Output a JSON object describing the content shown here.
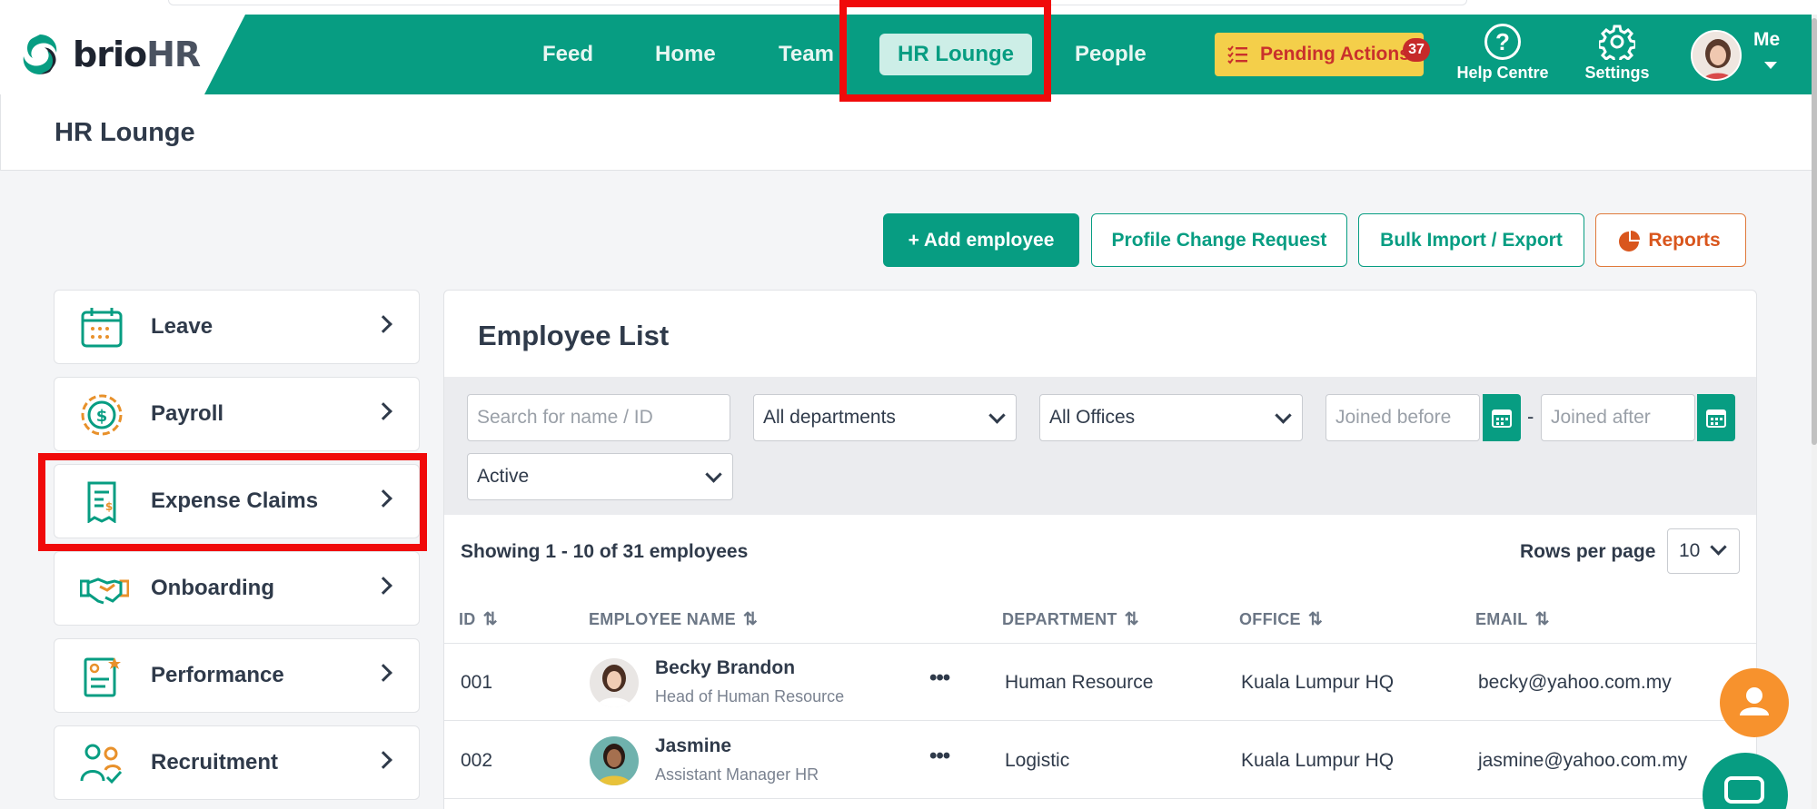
{
  "nav": {
    "brand": "brio",
    "brand_suffix": "HR",
    "links": {
      "feed": "Feed",
      "home": "Home",
      "team": "Team",
      "hr_lounge": "HR Lounge",
      "people": "People"
    },
    "pending_actions": {
      "label": "Pending Actions",
      "count": "37"
    },
    "help_centre": {
      "glyph": "?",
      "label": "Help Centre"
    },
    "settings": {
      "label": "Settings"
    },
    "user": {
      "label": "Me"
    },
    "active": "hr_lounge"
  },
  "page": {
    "title": "HR Lounge"
  },
  "actions": {
    "add_employee": "+  Add employee",
    "profile_change_request": "Profile Change Request",
    "bulk_import_export": "Bulk Import / Export",
    "reports": "Reports"
  },
  "sidebar": {
    "items": [
      {
        "label": "Leave",
        "icon": "calendar-icon"
      },
      {
        "label": "Payroll",
        "icon": "dollar-coin-icon"
      },
      {
        "label": "Expense Claims",
        "icon": "receipt-icon"
      },
      {
        "label": "Onboarding",
        "icon": "handshake-icon"
      },
      {
        "label": "Performance",
        "icon": "performance-clipboard-icon"
      },
      {
        "label": "Recruitment",
        "icon": "recruitment-people-icon"
      }
    ],
    "highlighted": "Expense Claims"
  },
  "employee_list": {
    "title": "Employee List",
    "filters": {
      "search_placeholder": "Search for name / ID",
      "department": "All departments",
      "office": "All Offices",
      "joined_before_placeholder": "Joined before",
      "separator": "-",
      "joined_after_placeholder": "Joined after",
      "status": "Active"
    },
    "showing": "Showing 1 - 10 of 31 employees",
    "rows_per_page_label": "Rows per page",
    "rows_per_page": "10",
    "columns": {
      "id": "ID",
      "name": "EMPLOYEE NAME",
      "department": "DEPARTMENT",
      "office": "OFFICE",
      "email": "EMAIL"
    },
    "rows": [
      {
        "id": "001",
        "name": "Becky Brandon",
        "title": "Head of Human Resource",
        "department": "Human Resource",
        "office": "Kuala Lumpur HQ",
        "email": "becky@yahoo.com.my",
        "more": "•••"
      },
      {
        "id": "002",
        "name": "Jasmine",
        "title": "Assistant Manager HR",
        "department": "Logistic",
        "office": "Kuala Lumpur HQ",
        "email": "jasmine@yahoo.com.my",
        "more": "•••"
      }
    ]
  },
  "colors": {
    "brand_green": "#079d82",
    "pending_yellow": "#f4cf4a",
    "highlight_red": "#f00a0a",
    "reports_orange": "#e0793b",
    "fab_orange": "#f7922d"
  }
}
